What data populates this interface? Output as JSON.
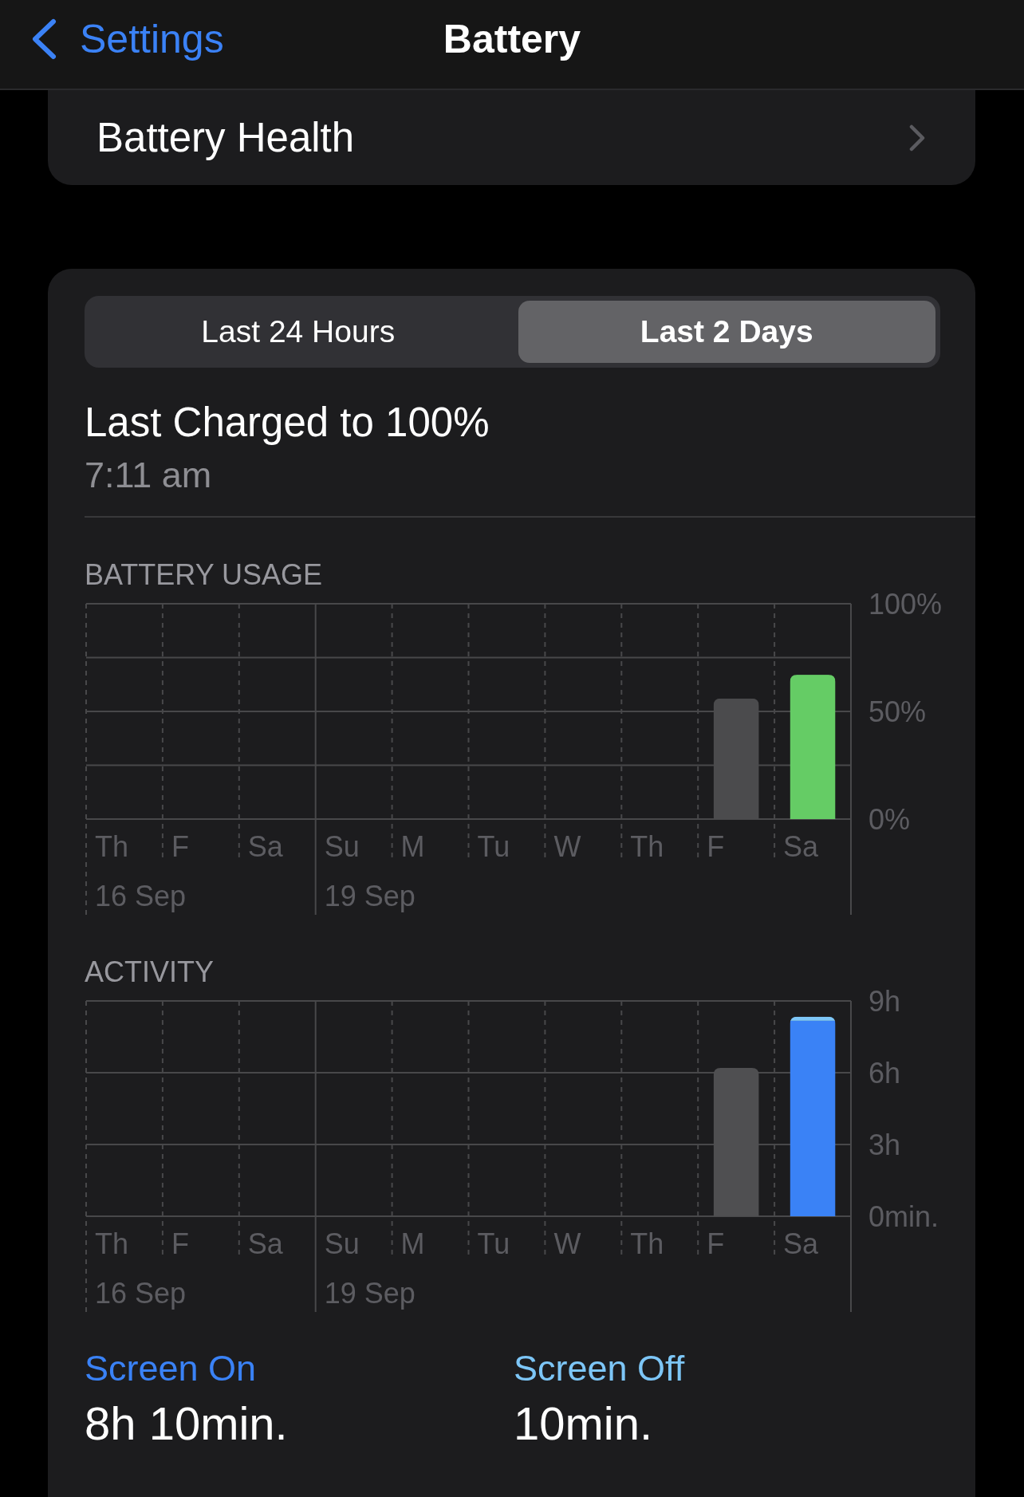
{
  "nav_bar": {
    "back_label": "Settings",
    "title": "Battery"
  },
  "battery_health": {
    "label": "Battery Health"
  },
  "period_tabs": [
    {
      "label": "Last 24 Hours",
      "selected": false
    },
    {
      "label": "Last 2 Days",
      "selected": true
    }
  ],
  "last_charged": {
    "title": "Last Charged to 100%",
    "time": "7:11 am"
  },
  "battery_usage": {
    "chart_data": {
      "type": "bar",
      "title": "BATTERY USAGE",
      "categories": [
        "Th",
        "F",
        "Sa",
        "Su",
        "M",
        "Tu",
        "W",
        "Th",
        "F",
        "Sa"
      ],
      "series": [
        {
          "color": "#4b4b4d",
          "values": [
            null,
            null,
            null,
            null,
            null,
            null,
            null,
            null,
            56,
            null
          ]
        },
        {
          "color": "#65cc65",
          "values": [
            null,
            null,
            null,
            null,
            null,
            null,
            null,
            null,
            null,
            67
          ]
        }
      ],
      "ylim": [
        0,
        100
      ],
      "yticks": [
        {
          "value": 0,
          "label": "0%"
        },
        {
          "value": 50,
          "label": "50%"
        },
        {
          "value": 100,
          "label": "100%"
        }
      ],
      "ref_lines": [
        {
          "axis": "y",
          "value": 25
        },
        {
          "axis": "y",
          "value": 75
        }
      ],
      "annotations": [
        "16 Sep",
        "19 Sep"
      ],
      "stacked": true
    }
  },
  "activity": {
    "chart_data": {
      "type": "bar",
      "title": "ACTIVITY",
      "categories": [
        "Th",
        "F",
        "Sa",
        "Su",
        "M",
        "Tu",
        "W",
        "Th",
        "F",
        "Sa"
      ],
      "series": [
        {
          "color": "#4f4f51",
          "values": [
            null,
            null,
            null,
            null,
            null,
            null,
            null,
            null,
            6.2,
            null
          ]
        },
        {
          "color": "#3a82f6",
          "values": [
            null,
            null,
            null,
            null,
            null,
            null,
            null,
            null,
            null,
            8.17
          ]
        },
        {
          "color": "#7dc6f7",
          "values": [
            null,
            null,
            null,
            null,
            null,
            null,
            null,
            null,
            null,
            0.17
          ]
        }
      ],
      "ylim": [
        0,
        9
      ],
      "yticks": [
        {
          "value": 0,
          "label": "0min."
        },
        {
          "value": 3,
          "label": "3h"
        },
        {
          "value": 6,
          "label": "6h"
        },
        {
          "value": 9,
          "label": "9h"
        }
      ],
      "annotations": [
        "16 Sep",
        "19 Sep"
      ],
      "stacked": true
    }
  },
  "screen_time": [
    {
      "label": "Screen On",
      "value": "8h 10min.",
      "color": "#3a82f6"
    },
    {
      "label": "Screen Off",
      "value": "10min.",
      "color": "#7dc6f7"
    }
  ]
}
